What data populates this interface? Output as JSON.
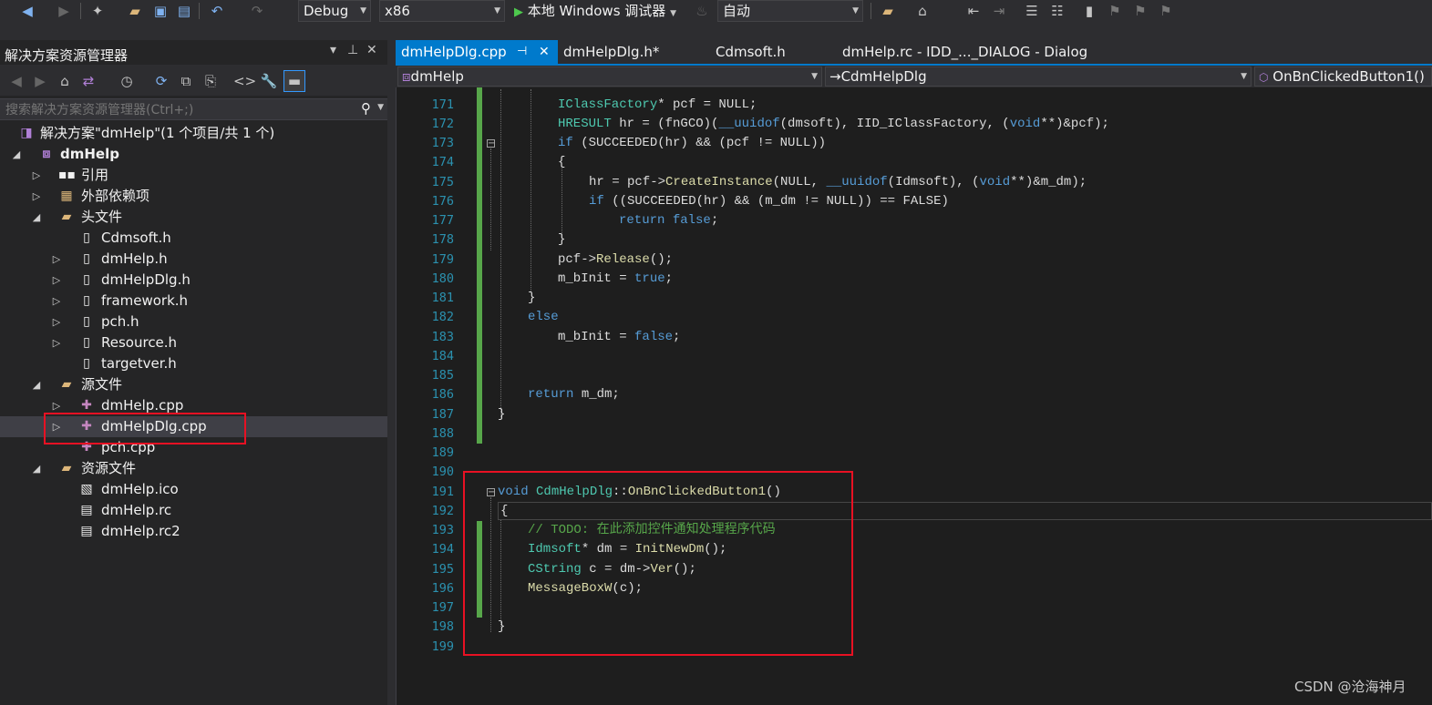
{
  "toolbar": {
    "config": "Debug",
    "platform": "x86",
    "run_label": "本地 Windows 调试器",
    "auto": "自动"
  },
  "solution_explorer": {
    "title": "解决方案资源管理器",
    "search_placeholder": "搜索解决方案资源管理器(Ctrl+;)",
    "solution": "解决方案\"dmHelp\"(1 个项目/共 1 个)",
    "project": "dmHelp",
    "nodes": [
      "引用",
      "外部依赖项",
      "头文件",
      "Cdmsoft.h",
      "dmHelp.h",
      "dmHelpDlg.h",
      "framework.h",
      "pch.h",
      "Resource.h",
      "targetver.h",
      "源文件",
      "dmHelp.cpp",
      "dmHelpDlg.cpp",
      "pch.cpp",
      "资源文件",
      "dmHelp.ico",
      "dmHelp.rc",
      "dmHelp.rc2"
    ]
  },
  "tabs": [
    "dmHelpDlg.cpp",
    "dmHelpDlg.h*",
    "Cdmsoft.h",
    "dmHelp.rc - IDD_..._DIALOG - Dialog"
  ],
  "nav": {
    "project": "dmHelp",
    "class": "CdmHelpDlg",
    "member": "OnBnClickedButton1()"
  },
  "code": {
    "line_numbers": [
      "171",
      "172",
      "173",
      "174",
      "175",
      "176",
      "177",
      "178",
      "179",
      "180",
      "181",
      "182",
      "183",
      "184",
      "185",
      "186",
      "187",
      "188",
      "189",
      "190",
      "191",
      "192",
      "193",
      "194",
      "195",
      "196",
      "197",
      "198",
      "199"
    ],
    "l171_type": "IClassFactory",
    "l171_rest": "* pcf = NULL;",
    "l172_a": "HRESULT",
    "l172_b": " hr = (fnGCO)(",
    "l172_c": "__uuidof",
    "l172_d": "(dmsoft), IID_IClassFactory, (",
    "l172_e": "void",
    "l172_f": "**)&pcf);",
    "l173_a": "if",
    "l173_b": " (SUCCEEDED(hr) && (pcf != NULL))",
    "l174": "{",
    "l175_a": "hr = pcf->",
    "l175_b": "CreateInstance",
    "l175_c": "(NULL, ",
    "l175_d": "__uuidof",
    "l175_e": "(Idmsoft), (",
    "l175_f": "void",
    "l175_g": "**)&m_dm);",
    "l176_a": "if",
    "l176_b": " ((SUCCEEDED(hr) && (m_dm != NULL)) == FALSE)",
    "l177_a": "return",
    "l177_b": " false",
    "l177_c": ";",
    "l178": "}",
    "l179_a": "pcf->",
    "l179_b": "Release",
    "l179_c": "();",
    "l180_a": "m_bInit = ",
    "l180_b": "true",
    "l180_c": ";",
    "l181": "}",
    "l182": "else",
    "l183_a": "m_bInit = ",
    "l183_b": "false",
    "l183_c": ";",
    "l186_a": "return",
    "l186_b": " m_dm;",
    "l187": "}",
    "l191_a": "void",
    "l191_b": " CdmHelpDlg",
    "l191_c": "::",
    "l191_d": "OnBnClickedButton1",
    "l191_e": "()",
    "l192": "{",
    "l193": "// TODO: 在此添加控件通知处理程序代码",
    "l194_a": "Idmsoft",
    "l194_b": "* dm = ",
    "l194_c": "InitNewDm",
    "l194_d": "();",
    "l195_a": "CString",
    "l195_b": " c = dm->",
    "l195_c": "Ver",
    "l195_d": "();",
    "l196_a": "MessageBoxW",
    "l196_b": "(c);",
    "l198": "}"
  },
  "watermark": "CSDN @沧海神月",
  "colors": {
    "accent": "#007acc",
    "highlight_box": "#e81123",
    "keyword": "#569cd6",
    "comment": "#57a64a",
    "type": "#4ec9b0",
    "function": "#dcdcaa"
  }
}
